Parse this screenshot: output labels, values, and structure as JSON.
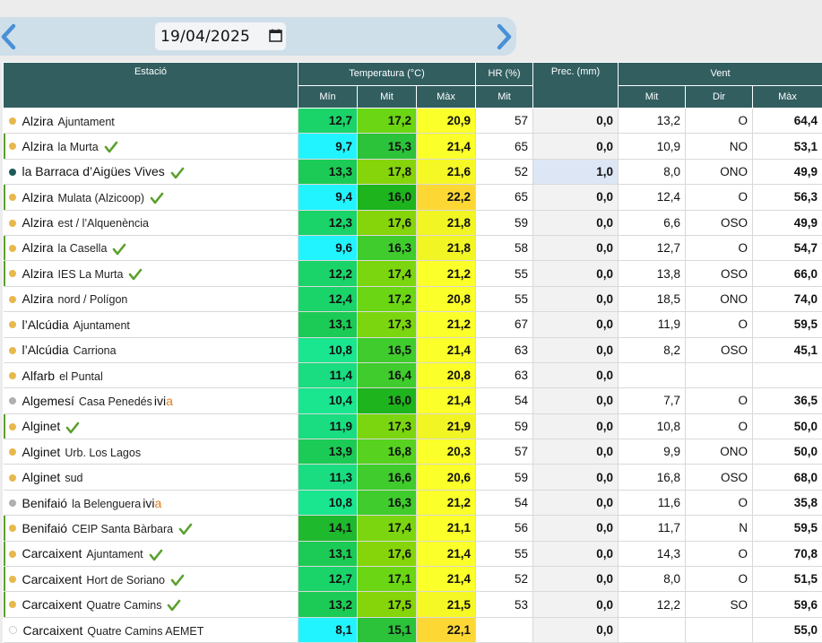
{
  "nav": {
    "date_value": "19/04/2025",
    "prev_icon": "chevron-left-icon",
    "next_icon": "chevron-right-icon",
    "calendar_icon": "calendar-icon",
    "accent_color": "#4a90d6"
  },
  "headers": {
    "station": "Estació",
    "temperature": "Temperatura (°C)",
    "humidity": "HR (%)",
    "precip": "Prec. (mm)",
    "wind": "Vent",
    "t_min": "Mín",
    "t_mit": "Mit",
    "t_max": "Màx",
    "hr_mit": "Mit",
    "w_mit": "Mit",
    "w_dir": "Dir",
    "w_max": "Màx"
  },
  "colors": {
    "header_bg": "#325e60",
    "dot_yellow": "#e7b84c",
    "dot_teal": "#1f5b5b",
    "dot_gray": "#b0b0b0",
    "check_green": "#5aa02c",
    "ivia_orange": "#e07b1a"
  },
  "rows": [
    {
      "town": "Alzira",
      "loc": "Ajuntament",
      "dot": "yellow",
      "bar": false,
      "check": false,
      "ivia": false,
      "tmin": "12,7",
      "tmit": "17,2",
      "tmax": "20,9",
      "hr": "57",
      "prec": "0,0",
      "wmit": "13,2",
      "wdir": "O",
      "wmax": "64,4"
    },
    {
      "town": "Alzira",
      "loc": "la Murta",
      "dot": "yellow",
      "bar": true,
      "check": true,
      "ivia": false,
      "tmin": "9,7",
      "tmit": "15,3",
      "tmax": "21,4",
      "hr": "65",
      "prec": "0,0",
      "wmit": "10,9",
      "wdir": "NO",
      "wmax": "53,1"
    },
    {
      "town": "la Barraca d’Aigües Vives",
      "loc": "",
      "dot": "teal",
      "bar": false,
      "check": true,
      "ivia": false,
      "tmin": "13,3",
      "tmit": "17,8",
      "tmax": "21,6",
      "hr": "52",
      "prec": "1,0",
      "wmit": "8,0",
      "wdir": "ONO",
      "wmax": "49,9"
    },
    {
      "town": "Alzira",
      "loc": "Mulata (Alzicoop)",
      "dot": "yellow",
      "bar": true,
      "check": true,
      "ivia": false,
      "tmin": "9,4",
      "tmit": "16,0",
      "tmax": "22,2",
      "hr": "65",
      "prec": "0,0",
      "wmit": "12,4",
      "wdir": "O",
      "wmax": "56,3"
    },
    {
      "town": "Alzira",
      "loc": "est / l’Alquenència",
      "dot": "yellow",
      "bar": false,
      "check": false,
      "ivia": false,
      "tmin": "12,3",
      "tmit": "17,6",
      "tmax": "21,8",
      "hr": "59",
      "prec": "0,0",
      "wmit": "6,6",
      "wdir": "OSO",
      "wmax": "49,9"
    },
    {
      "town": "Alzira",
      "loc": "la Casella",
      "dot": "yellow",
      "bar": true,
      "check": true,
      "ivia": false,
      "tmin": "9,6",
      "tmit": "16,3",
      "tmax": "21,8",
      "hr": "58",
      "prec": "0,0",
      "wmit": "12,7",
      "wdir": "O",
      "wmax": "54,7"
    },
    {
      "town": "Alzira",
      "loc": "IES La Murta",
      "dot": "yellow",
      "bar": true,
      "check": true,
      "ivia": false,
      "tmin": "12,2",
      "tmit": "17,4",
      "tmax": "21,2",
      "hr": "55",
      "prec": "0,0",
      "wmit": "13,8",
      "wdir": "OSO",
      "wmax": "66,0"
    },
    {
      "town": "Alzira",
      "loc": "nord / Polígon",
      "dot": "yellow",
      "bar": false,
      "check": false,
      "ivia": false,
      "tmin": "12,4",
      "tmit": "17,2",
      "tmax": "20,8",
      "hr": "55",
      "prec": "0,0",
      "wmit": "18,5",
      "wdir": "ONO",
      "wmax": "74,0"
    },
    {
      "town": "l’Alcúdia",
      "loc": "Ajuntament",
      "dot": "yellow",
      "bar": false,
      "check": false,
      "ivia": false,
      "tmin": "13,1",
      "tmit": "17,3",
      "tmax": "21,2",
      "hr": "67",
      "prec": "0,0",
      "wmit": "11,9",
      "wdir": "O",
      "wmax": "59,5"
    },
    {
      "town": "l’Alcúdia",
      "loc": "Carriona",
      "dot": "yellow",
      "bar": false,
      "check": false,
      "ivia": false,
      "tmin": "10,8",
      "tmit": "16,5",
      "tmax": "21,4",
      "hr": "63",
      "prec": "0,0",
      "wmit": "8,2",
      "wdir": "OSO",
      "wmax": "45,1"
    },
    {
      "town": "Alfarb",
      "loc": "el Puntal",
      "dot": "yellow",
      "bar": false,
      "check": false,
      "ivia": false,
      "tmin": "11,4",
      "tmit": "16,4",
      "tmax": "20,8",
      "hr": "63",
      "prec": "0,0",
      "wmit": "",
      "wdir": "",
      "wmax": ""
    },
    {
      "town": "Algemesí",
      "loc": "Casa Penedés",
      "dot": "gray",
      "bar": false,
      "check": false,
      "ivia": true,
      "tmin": "10,4",
      "tmit": "16,0",
      "tmax": "21,4",
      "hr": "54",
      "prec": "0,0",
      "wmit": "7,7",
      "wdir": "O",
      "wmax": "36,5"
    },
    {
      "town": "Alginet",
      "loc": "",
      "dot": "yellow",
      "bar": true,
      "check": true,
      "ivia": false,
      "tmin": "11,9",
      "tmit": "17,3",
      "tmax": "21,9",
      "hr": "59",
      "prec": "0,0",
      "wmit": "10,8",
      "wdir": "O",
      "wmax": "50,0"
    },
    {
      "town": "Alginet",
      "loc": "Urb. Los Lagos",
      "dot": "yellow",
      "bar": false,
      "check": false,
      "ivia": false,
      "tmin": "13,9",
      "tmit": "16,8",
      "tmax": "20,3",
      "hr": "57",
      "prec": "0,0",
      "wmit": "9,9",
      "wdir": "ONO",
      "wmax": "50,0"
    },
    {
      "town": "Alginet",
      "loc": "sud",
      "dot": "yellow",
      "bar": false,
      "check": false,
      "ivia": false,
      "tmin": "11,3",
      "tmit": "16,6",
      "tmax": "20,6",
      "hr": "59",
      "prec": "0,0",
      "wmit": "16,8",
      "wdir": "OSO",
      "wmax": "68,0"
    },
    {
      "town": "Benifaió",
      "loc": "la Belenguera",
      "dot": "gray",
      "bar": false,
      "check": false,
      "ivia": true,
      "tmin": "10,8",
      "tmit": "16,3",
      "tmax": "21,2",
      "hr": "54",
      "prec": "0,0",
      "wmit": "11,6",
      "wdir": "O",
      "wmax": "35,8"
    },
    {
      "town": "Benifaió",
      "loc": "CEIP Santa Bàrbara",
      "dot": "yellow",
      "bar": true,
      "check": true,
      "ivia": false,
      "tmin": "14,1",
      "tmit": "17,4",
      "tmax": "21,1",
      "hr": "56",
      "prec": "0,0",
      "wmit": "11,7",
      "wdir": "N",
      "wmax": "59,5"
    },
    {
      "town": "Carcaixent",
      "loc": "Ajuntament",
      "dot": "yellow",
      "bar": true,
      "check": true,
      "ivia": false,
      "tmin": "13,1",
      "tmit": "17,6",
      "tmax": "21,4",
      "hr": "55",
      "prec": "0,0",
      "wmit": "14,3",
      "wdir": "O",
      "wmax": "70,8"
    },
    {
      "town": "Carcaixent",
      "loc": "Hort de Soriano",
      "dot": "yellow",
      "bar": true,
      "check": true,
      "ivia": false,
      "tmin": "12,7",
      "tmit": "17,1",
      "tmax": "21,4",
      "hr": "52",
      "prec": "0,0",
      "wmit": "8,0",
      "wdir": "O",
      "wmax": "51,5"
    },
    {
      "town": "Carcaixent",
      "loc": "Quatre Camins",
      "dot": "yellow",
      "bar": true,
      "check": true,
      "ivia": false,
      "tmin": "13,2",
      "tmit": "17,5",
      "tmax": "21,5",
      "hr": "53",
      "prec": "0,0",
      "wmit": "12,2",
      "wdir": "SO",
      "wmax": "59,6"
    },
    {
      "town": "Carcaixent",
      "loc": "Quatre Camins AEMET",
      "dot": "hollow",
      "bar": false,
      "check": false,
      "ivia": false,
      "tmin": "8,1",
      "tmit": "15,1",
      "tmax": "22,1",
      "hr": "",
      "prec": "0,0",
      "wmit": "",
      "wdir": "",
      "wmax": "55,0"
    }
  ],
  "ivia_label": {
    "prefix": "ivi",
    "suffix": "a"
  }
}
